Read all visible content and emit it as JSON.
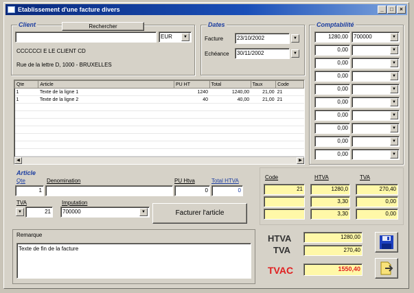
{
  "window": {
    "title": "Etablissement d'une facture divers",
    "btn_min": "_",
    "btn_max": "□",
    "btn_close": "×"
  },
  "client": {
    "group_title": "Client",
    "search_button": "Rechercher",
    "search_value": "",
    "currency": "EUR",
    "name": "CCCCCCI E LE CLIENT CD",
    "address": "Rue de la lettre D, 1000 - BRUXELLES"
  },
  "dates": {
    "group_title": "Dates",
    "invoice_label": "Facture",
    "invoice_date": "23/10/2002",
    "due_label": "Echéance",
    "due_date": "30/11/2002"
  },
  "accounting": {
    "group_title": "Comptabilité",
    "rows": [
      {
        "amount": "1280,00",
        "account": "700000"
      },
      {
        "amount": "0,00",
        "account": ""
      },
      {
        "amount": "0,00",
        "account": ""
      },
      {
        "amount": "0,00",
        "account": ""
      },
      {
        "amount": "0,00",
        "account": ""
      },
      {
        "amount": "0,00",
        "account": ""
      },
      {
        "amount": "0,00",
        "account": ""
      },
      {
        "amount": "0,00",
        "account": ""
      },
      {
        "amount": "0,00",
        "account": ""
      },
      {
        "amount": "0,00",
        "account": ""
      }
    ]
  },
  "lines": {
    "headers": [
      "Qte",
      "Article",
      "PU HT",
      "Total",
      "Taux",
      "Code"
    ],
    "rows": [
      [
        "1",
        "Texte de la ligne 1",
        "1240",
        "1240,00",
        "21,00",
        "21"
      ],
      [
        "1",
        "Texte de la ligne 2",
        "40",
        "40,00",
        "21,00",
        "21"
      ]
    ],
    "empty_rows": 8
  },
  "article": {
    "group_title": "Article",
    "qty_label": "Qte",
    "desc_label": "Denomination",
    "pu_label": "PU Htva",
    "total_label": "Total HTVA",
    "qty_value": "1",
    "desc_value": "",
    "pu_value": "0",
    "total_value": "0",
    "tva_label": "TVA",
    "imputation_label": "Imputation",
    "tva_value": "21",
    "imputation_value": "700000",
    "invoice_button": "Facturer l'article"
  },
  "vat_summary": {
    "code_label": "Code",
    "htva_label": "HTVA",
    "tva_label": "TVA",
    "rows": [
      {
        "code": "21",
        "htva": "1280,0",
        "tva": "270,40"
      },
      {
        "code": "",
        "htva": "3,30",
        "tva": "0,00"
      },
      {
        "code": "",
        "htva": "3,30",
        "tva": "0,00"
      }
    ]
  },
  "remark": {
    "label": "Remarque",
    "text": "Texte de fin de la facture"
  },
  "totals": {
    "htva_label": "HTVA",
    "htva_value": "1280,00",
    "tva_label": "TVA",
    "tva_value": "270,40",
    "tvac_label": "TVAC",
    "tvac_value": "1550,40",
    "tvac_color": "#e02020"
  }
}
